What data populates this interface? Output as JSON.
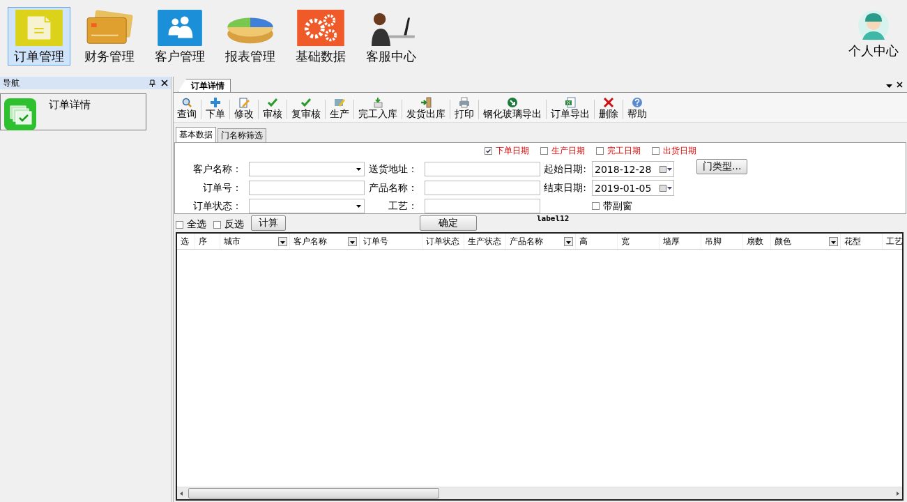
{
  "modules": [
    {
      "label": "订单管理",
      "selected": true
    },
    {
      "label": "财务管理",
      "selected": false
    },
    {
      "label": "客户管理",
      "selected": false
    },
    {
      "label": "报表管理",
      "selected": false
    },
    {
      "label": "基础数据",
      "selected": false
    },
    {
      "label": "客服中心",
      "selected": false
    }
  ],
  "user_center": {
    "label": "个人中心"
  },
  "nav": {
    "title": "导航",
    "items": [
      {
        "label": "订单详情"
      }
    ]
  },
  "document_tab": {
    "label": "订单详情"
  },
  "toolbar": [
    "查询",
    "下单",
    "修改",
    "审核",
    "复审核",
    "生产",
    "完工入库",
    "发货出库",
    "打印",
    "钢化玻璃导出",
    "订单导出",
    "删除",
    "帮助"
  ],
  "subtabs": [
    {
      "label": "基本数据",
      "selected": true
    },
    {
      "label": "门名称筛选",
      "selected": false
    }
  ],
  "date_filters": [
    {
      "label": "下单日期",
      "checked": true
    },
    {
      "label": "生产日期",
      "checked": false
    },
    {
      "label": "完工日期",
      "checked": false
    },
    {
      "label": "出货日期",
      "checked": false
    }
  ],
  "fields": [
    {
      "kind": "combo",
      "label": "客户名称："
    },
    {
      "kind": "text",
      "label": "送货地址："
    },
    {
      "kind": "date",
      "label": "起始日期:",
      "value": "2018-12-28"
    },
    {
      "kind": "text",
      "label": "订单号："
    },
    {
      "kind": "text",
      "label": "产品名称："
    },
    {
      "kind": "date",
      "label": "结束日期:",
      "value": "2019-01-05"
    },
    {
      "kind": "combo",
      "label": "订单状态："
    },
    {
      "kind": "text",
      "label": "工艺："
    },
    {
      "kind": "checkbox",
      "label": "带副窗",
      "checked": false
    }
  ],
  "door_type_button": "门类型...",
  "select_all": {
    "label": "全选",
    "checked": false
  },
  "invert": {
    "label": "反选",
    "checked": false
  },
  "calc_button": "计算",
  "ok_button": "确定",
  "status_label": "label12",
  "columns": [
    {
      "label": "选",
      "filter": false
    },
    {
      "label": "序",
      "filter": false
    },
    {
      "label": "城市",
      "filter": true
    },
    {
      "label": "客户名称",
      "filter": true
    },
    {
      "label": "订单号",
      "filter": false
    },
    {
      "label": "订单状态",
      "filter": false
    },
    {
      "label": "生产状态",
      "filter": false
    },
    {
      "label": "产品名称",
      "filter": true
    },
    {
      "label": "高",
      "filter": false
    },
    {
      "label": "宽",
      "filter": false
    },
    {
      "label": "墙厚",
      "filter": false
    },
    {
      "label": "吊脚",
      "filter": false
    },
    {
      "label": "扇数",
      "filter": false
    },
    {
      "label": "颜色",
      "filter": true
    },
    {
      "label": "花型",
      "filter": false
    },
    {
      "label": "工艺",
      "filter": false
    }
  ]
}
